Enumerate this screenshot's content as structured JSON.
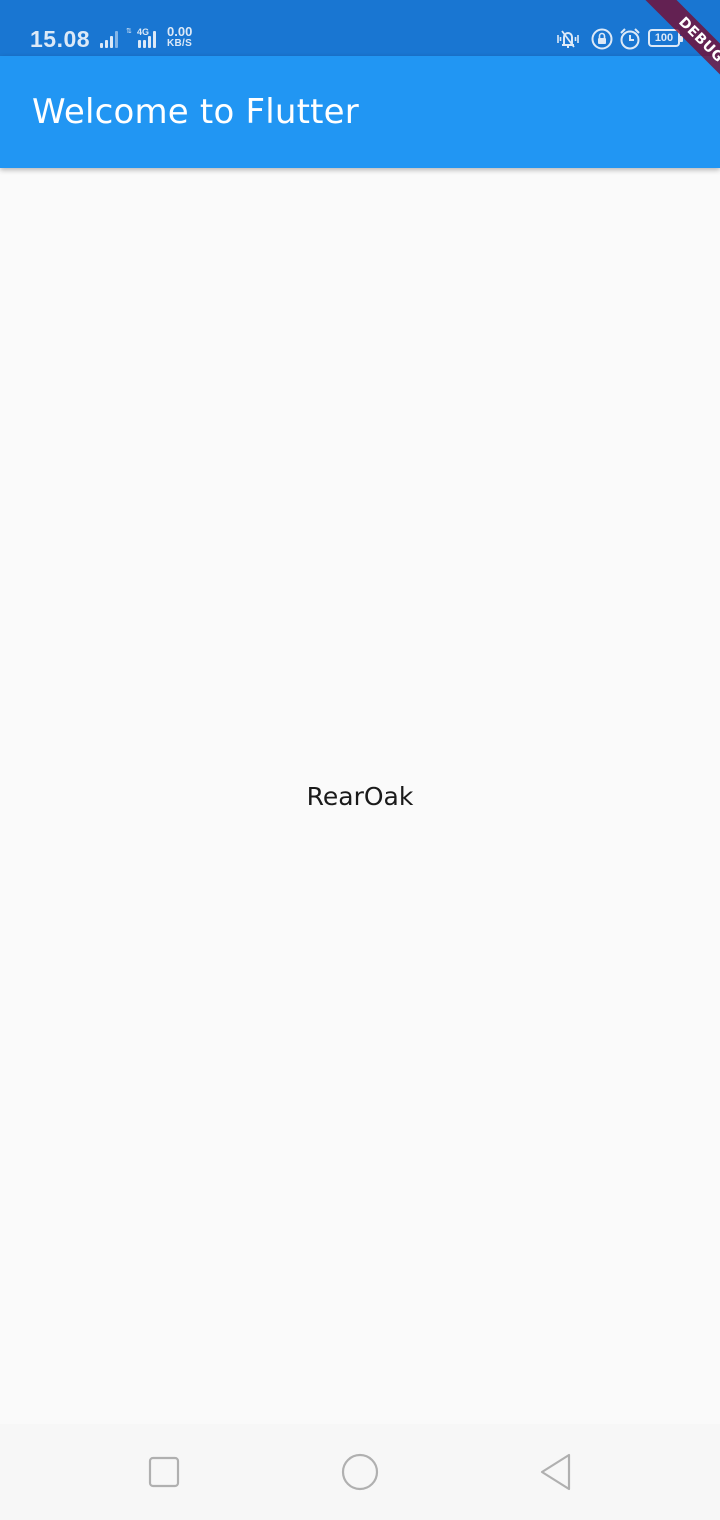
{
  "status_bar": {
    "time": "15.08",
    "network_type": "4G",
    "speed_value": "0.00",
    "speed_unit": "KB/S",
    "battery_level": "100",
    "background_color": "#1976d2",
    "icons": [
      "signal-icon",
      "signal-icon",
      "vibrate-icon",
      "lock-rotation-icon",
      "alarm-icon",
      "battery-icon"
    ]
  },
  "app_bar": {
    "title": "Welcome to Flutter",
    "background_color": "#2196f3"
  },
  "body": {
    "text": "RearOak",
    "background_color": "#fafafa"
  },
  "debug_banner": {
    "label": "DEBUG",
    "color": "#800020"
  },
  "nav_bar": {
    "buttons": [
      "recents-icon",
      "home-icon",
      "back-icon"
    ]
  }
}
